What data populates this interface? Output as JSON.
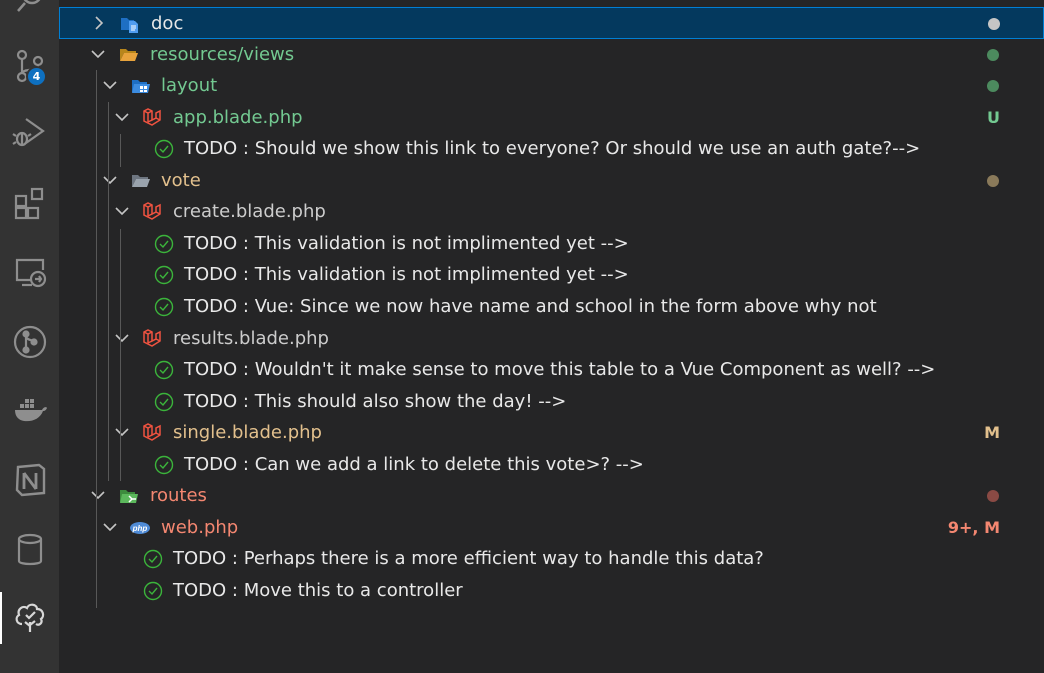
{
  "activity_bar": {
    "items": [
      {
        "name": "search-icon",
        "active": false
      },
      {
        "name": "source-control-icon",
        "active": false
      },
      {
        "name": "run-debug-icon",
        "active": false
      },
      {
        "name": "extensions-icon",
        "active": false
      },
      {
        "name": "remote-explorer-icon",
        "active": false
      },
      {
        "name": "gitlens-icon",
        "active": false
      },
      {
        "name": "docker-icon",
        "active": false
      },
      {
        "name": "notion-icon",
        "active": false
      },
      {
        "name": "database-icon",
        "active": false
      },
      {
        "name": "todo-tree-icon",
        "active": true
      }
    ],
    "source_control_badge": "4"
  },
  "colors": {
    "activity_bg": "#333333",
    "tree_bg": "#252526",
    "selection_bg": "#04395e",
    "selection_border": "#007fd4",
    "text_default": "#cccccc",
    "text_untracked": "#73c991",
    "text_modified": "#e2c08d",
    "text_error": "#f48771",
    "todo_check": "#3bb43b",
    "laravel_red": "#f05340",
    "folder_yellow": "#e8a33c"
  },
  "tree": {
    "items": [
      {
        "kind": "folder",
        "label": "doc",
        "expanded": false,
        "icon": "doc-folder-icon",
        "color": "#e7e7e7",
        "dot": "#c5c5c5",
        "selected": true
      },
      {
        "kind": "folder",
        "label": "resources/views",
        "expanded": true,
        "icon": "folder-open-icon",
        "color": "#73c991",
        "dot": "#4c8a5e"
      },
      {
        "kind": "folder",
        "label": "layout",
        "expanded": true,
        "icon": "layout-folder-icon",
        "color": "#73c991",
        "dot": "#4c8a5e"
      },
      {
        "kind": "file",
        "label": "app.blade.php",
        "expanded": true,
        "icon": "laravel-icon",
        "color": "#73c991",
        "decoration": "U",
        "deco_color": "#73c991"
      },
      {
        "kind": "todo",
        "label": "TODO : Should we show this link to everyone? Or should we use an auth gate?-->"
      },
      {
        "kind": "folder",
        "label": "vote",
        "expanded": true,
        "icon": "folder-open-gray-icon",
        "color": "#e2c08d",
        "dot": "#8a7a5a"
      },
      {
        "kind": "file",
        "label": "create.blade.php",
        "expanded": true,
        "icon": "laravel-icon",
        "color": "#cccccc"
      },
      {
        "kind": "todo",
        "label": "TODO : This validation is not implimented yet -->"
      },
      {
        "kind": "todo",
        "label": "TODO : This validation is not implimented yet -->"
      },
      {
        "kind": "todo",
        "label": "TODO : Vue: Since we now have name and school in the form above why not"
      },
      {
        "kind": "file",
        "label": "results.blade.php",
        "expanded": true,
        "icon": "laravel-icon",
        "color": "#cccccc"
      },
      {
        "kind": "todo",
        "label": "TODO : Wouldn't it make sense to move this table to a Vue Component as well? -->"
      },
      {
        "kind": "todo",
        "label": "TODO : This should also show the day! -->"
      },
      {
        "kind": "file",
        "label": "single.blade.php",
        "expanded": true,
        "icon": "laravel-icon",
        "color": "#e2c08d",
        "decoration": "M",
        "deco_color": "#e2c08d"
      },
      {
        "kind": "todo",
        "label": "TODO : Can we add a link to delete this vote>? -->"
      },
      {
        "kind": "folder",
        "label": "routes",
        "expanded": true,
        "icon": "routes-folder-icon",
        "color": "#f48771",
        "dot": "#8a4a44"
      },
      {
        "kind": "file",
        "label": "web.php",
        "expanded": true,
        "icon": "php-icon",
        "color": "#f48771",
        "decoration": "9+, M",
        "deco_color": "#f48771"
      },
      {
        "kind": "todo",
        "label": "TODO : Perhaps there is a more efficient way to handle this data?"
      },
      {
        "kind": "todo",
        "label": "TODO : Move this to a controller"
      }
    ]
  }
}
